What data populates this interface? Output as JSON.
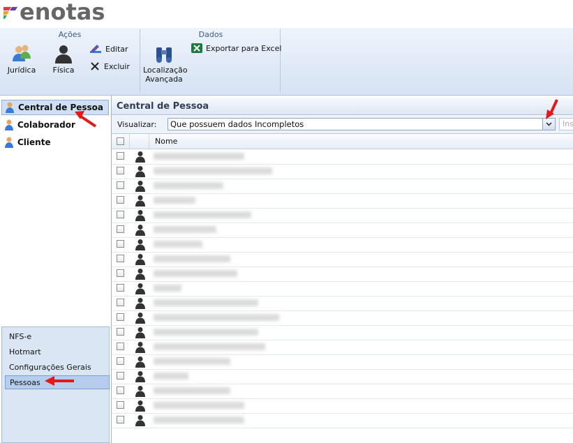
{
  "brand": {
    "name": "enotas"
  },
  "ribbon": {
    "groups": [
      {
        "title": "Ações"
      },
      {
        "title": "Dados"
      }
    ],
    "buttons": {
      "juridica": "Jurídica",
      "fisica": "Física",
      "editar": "Editar",
      "excluir": "Excluir",
      "localizacao": "Localização Avançada",
      "exportar": "Exportar para Excel"
    }
  },
  "sidebar": {
    "items": [
      {
        "label": "Central de Pessoa",
        "selected": true
      },
      {
        "label": "Colaborador",
        "selected": false
      },
      {
        "label": "Cliente",
        "selected": false
      }
    ],
    "modules": [
      {
        "label": "NFS-e",
        "selected": false
      },
      {
        "label": "Hotmart",
        "selected": false
      },
      {
        "label": "Configurações Gerais",
        "selected": false
      },
      {
        "label": "Pessoas",
        "selected": true
      }
    ]
  },
  "main": {
    "title": "Central de Pessoa",
    "filter": {
      "label": "Visualizar:",
      "selected": "Que possuem dados Incompletos",
      "search_placeholder": "Ins"
    },
    "grid": {
      "columns": [
        "Nome"
      ]
    }
  },
  "colors": {
    "accent": "#3a5a8c",
    "selection": "#cfe0f5",
    "annotation": "#e0191b"
  }
}
